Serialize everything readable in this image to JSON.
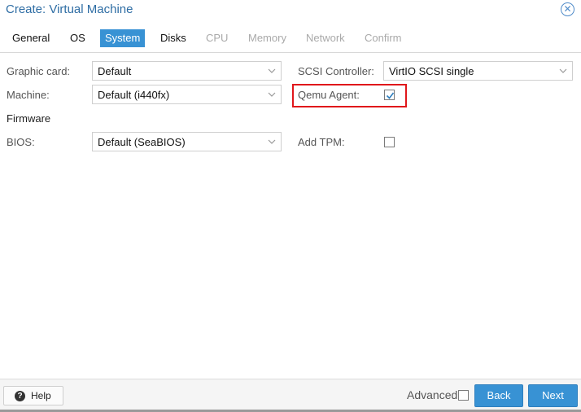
{
  "dialog": {
    "title": "Create: Virtual Machine",
    "close_icon": "close-circle-icon"
  },
  "tabs": [
    {
      "label": "General",
      "state": "enabled"
    },
    {
      "label": "OS",
      "state": "enabled"
    },
    {
      "label": "System",
      "state": "active"
    },
    {
      "label": "Disks",
      "state": "enabled"
    },
    {
      "label": "CPU",
      "state": "disabled"
    },
    {
      "label": "Memory",
      "state": "disabled"
    },
    {
      "label": "Network",
      "state": "disabled"
    },
    {
      "label": "Confirm",
      "state": "disabled"
    }
  ],
  "form": {
    "graphic_card": {
      "label": "Graphic card:",
      "value": "Default"
    },
    "machine": {
      "label": "Machine:",
      "value": "Default (i440fx)"
    },
    "firmware_heading": "Firmware",
    "bios": {
      "label": "BIOS:",
      "value": "Default (SeaBIOS)"
    },
    "scsi_controller": {
      "label": "SCSI Controller:",
      "value": "VirtIO SCSI single"
    },
    "qemu_agent": {
      "label": "Qemu Agent:",
      "checked": true
    },
    "add_tpm": {
      "label": "Add TPM:",
      "checked": false
    }
  },
  "footer": {
    "help_label": "Help",
    "advanced_label": "Advanced",
    "advanced_checked": false,
    "back_label": "Back",
    "next_label": "Next"
  },
  "colors": {
    "accent": "#3892d4",
    "title": "#2e6da4",
    "highlight_box": "#e0171b"
  }
}
